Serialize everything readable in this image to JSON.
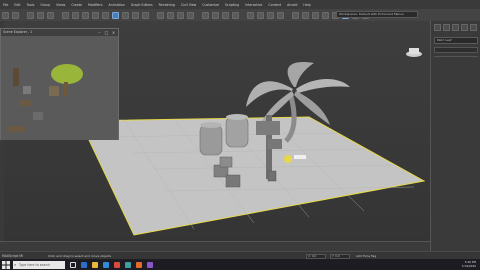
{
  "menubar": {
    "items": [
      "File",
      "Edit",
      "Tools",
      "Group",
      "Views",
      "Create",
      "Modifiers",
      "Animation",
      "Graph Editors",
      "Rendering",
      "Civil View",
      "Customize",
      "Scripting",
      "Interactive",
      "Content",
      "Arnold",
      "Help"
    ]
  },
  "toolbar": {
    "workspace_value": "Workspaces: Default with Enhanced Menus"
  },
  "scene_panel": {
    "title": "Scene Explorer - 1"
  },
  "command_panel": {
    "field_value": "Palm Leaf"
  },
  "statusbar": {
    "script_label": "MAXScript Mi",
    "prompt": "Click and drag to select and move objects",
    "x_value": "X: 0.0",
    "y_value": "Y: 0.0",
    "add_time": "Add Time Tag"
  },
  "taskbar": {
    "search_placeholder": "Type here to search",
    "time": "5:46 PM",
    "date": "7/19/2020"
  },
  "colors": {
    "selection_yellow": "#e6d84a",
    "grid_plane": "#c2c2c2",
    "accent_blue": "#4c7fb5"
  }
}
